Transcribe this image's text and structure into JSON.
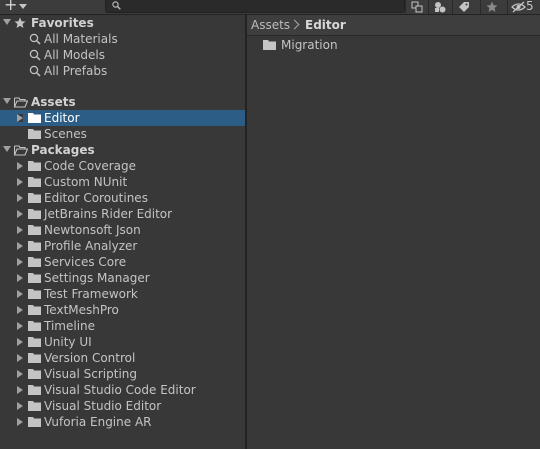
{
  "toolbar": {
    "visible_count": "5"
  },
  "favorites": {
    "label": "Favorites",
    "items": [
      "All Materials",
      "All Models",
      "All Prefabs"
    ]
  },
  "assets": {
    "label": "Assets",
    "children": [
      "Editor",
      "Scenes"
    ],
    "selected": "Editor"
  },
  "packages": {
    "label": "Packages",
    "items": [
      "Code Coverage",
      "Custom NUnit",
      "Editor Coroutines",
      "JetBrains Rider Editor",
      "Newtonsoft Json",
      "Profile Analyzer",
      "Services Core",
      "Settings Manager",
      "Test Framework",
      "TextMeshPro",
      "Timeline",
      "Unity UI",
      "Version Control",
      "Visual Scripting",
      "Visual Studio Code Editor",
      "Visual Studio Editor",
      "Vuforia Engine AR"
    ]
  },
  "breadcrumb": {
    "root": "Assets",
    "current": "Editor"
  },
  "content": {
    "folders": [
      "Migration"
    ]
  },
  "colors": {
    "selection": "#2c5d87",
    "panel": "#383838",
    "toolbar": "#3c3c3c"
  }
}
